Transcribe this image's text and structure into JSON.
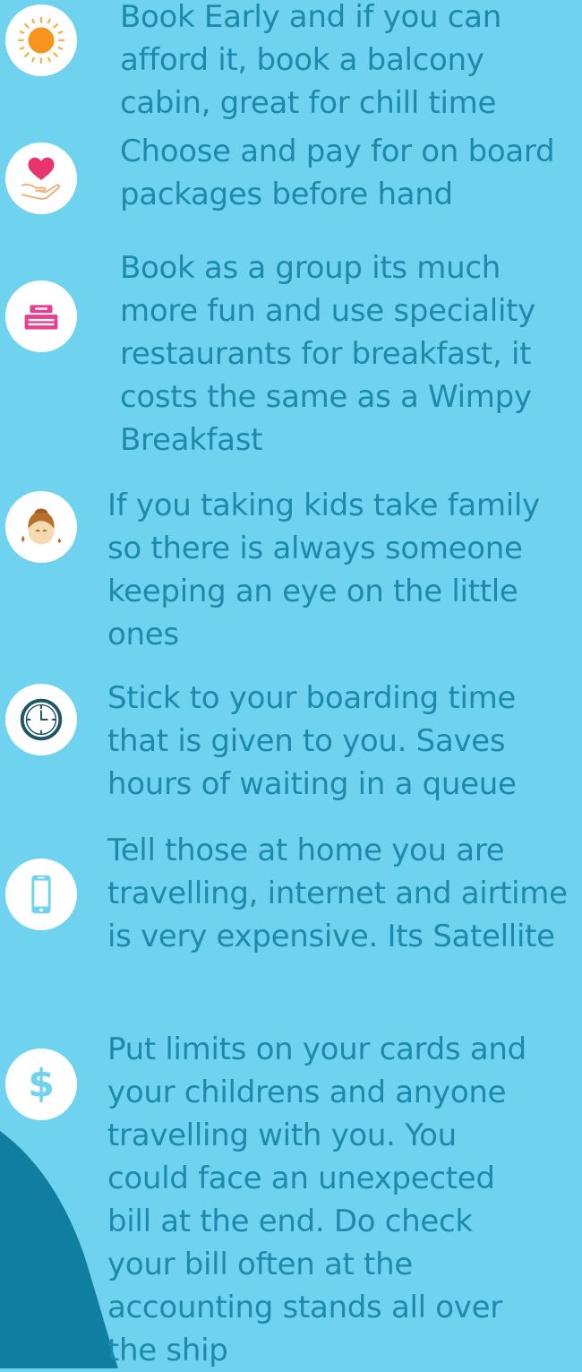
{
  "tips": [
    {
      "icon": "sun-icon",
      "text": "Book Early and if you can afford it, book a balcony cabin, great for chill time"
    },
    {
      "icon": "heart-in-hand-icon",
      "text": "Choose and pay for on board packages before hand"
    },
    {
      "icon": "cake-icon",
      "text": "Book as a group its much more fun and use speciality restaurants for breakfast, it costs the same as a Wimpy Breakfast"
    },
    {
      "icon": "child-face-icon",
      "text": "If you taking kids take family so there is always someone keeping an eye on the little ones"
    },
    {
      "icon": "clock-icon",
      "text": "Stick to your boarding time that is given to you. Saves hours of waiting in a queue"
    },
    {
      "icon": "mobile-phone-icon",
      "text": "Tell those at home you are travelling, internet and airtime is very expensive. Its Satellite"
    },
    {
      "icon": "dollar-icon",
      "text": "Put limits on your cards and your childrens and anyone travelling with you. You could face an unexpected bill at the end. Do check your bill often at the accounting stands all over the ship"
    }
  ],
  "colors": {
    "background": "#6fd3ef",
    "text": "#1d8aab",
    "wave": "#0f7ea1",
    "icon_background": "#ffffff"
  }
}
